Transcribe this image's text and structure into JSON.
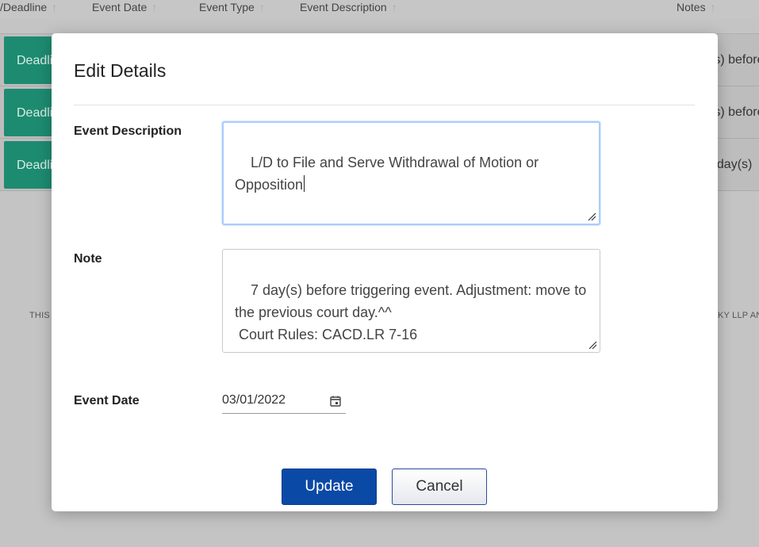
{
  "background": {
    "columns": [
      {
        "label": "/Deadline"
      },
      {
        "label": "Event Date"
      },
      {
        "label": "Event Type"
      },
      {
        "label": "Event Description"
      },
      {
        "label": "Notes"
      }
    ],
    "rows": [
      {
        "badge": "Deadline",
        "note": "(s) before"
      },
      {
        "badge": "Deadline",
        "note": "(s) before"
      },
      {
        "badge": "Deadline",
        "note": "t day(s)"
      }
    ],
    "footer_left": "THIS",
    "footer_right": "KY LLP AN"
  },
  "modal": {
    "title": "Edit Details",
    "event_description": {
      "label": "Event Description",
      "value": "L/D to File and Serve Withdrawal of Motion or Opposition"
    },
    "note": {
      "label": "Note",
      "value": "7 day(s) before triggering event. Adjustment: move to the previous court day.^^\n Court Rules: CACD.LR 7-16"
    },
    "event_date": {
      "label": "Event Date",
      "value": "03/01/2022"
    },
    "buttons": {
      "update": "Update",
      "cancel": "Cancel"
    }
  },
  "colors": {
    "primary": "#0a49a6",
    "deadline_badge": "#1d8b70",
    "focus_ring": "#a8cdfc"
  },
  "icons": {
    "sort": "arrow-up-icon",
    "calendar": "calendar-icon",
    "resize": "resize-grip-icon"
  }
}
